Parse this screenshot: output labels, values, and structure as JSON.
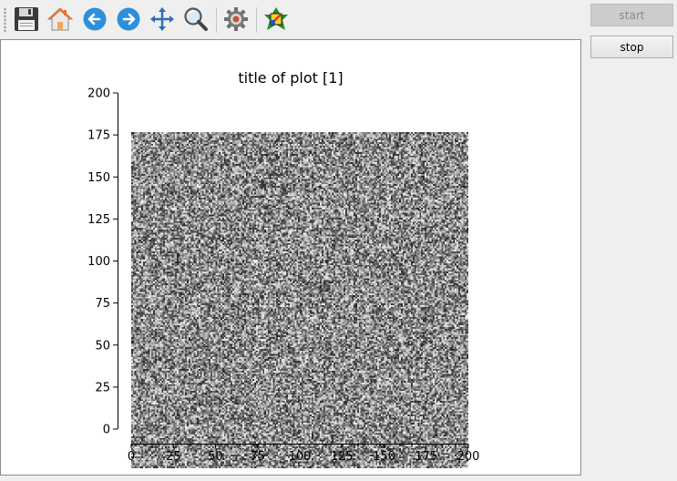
{
  "toolbar": {
    "icons": [
      "save-icon",
      "home-icon",
      "back-arrow-icon",
      "forward-arrow-icon",
      "pan-icon",
      "zoom-icon",
      "configure-subplots-icon",
      "edit-axes-icon"
    ]
  },
  "buttons": {
    "start_label": "start",
    "stop_label": "stop",
    "start_enabled": false
  },
  "plot": {
    "title": "title of plot [1]"
  },
  "chart_data": {
    "type": "heatmap",
    "title": "title of plot [1]",
    "xlabel": "",
    "ylabel": "",
    "xlim": [
      0,
      200
    ],
    "ylim": [
      0,
      200
    ],
    "xticks": [
      0,
      25,
      50,
      75,
      100,
      125,
      150,
      175,
      200
    ],
    "yticks": [
      0,
      25,
      50,
      75,
      100,
      125,
      150,
      175,
      200
    ],
    "grid_size": [
      200,
      200
    ],
    "colormap": "gray",
    "content": "uniform random noise",
    "grid": false
  }
}
